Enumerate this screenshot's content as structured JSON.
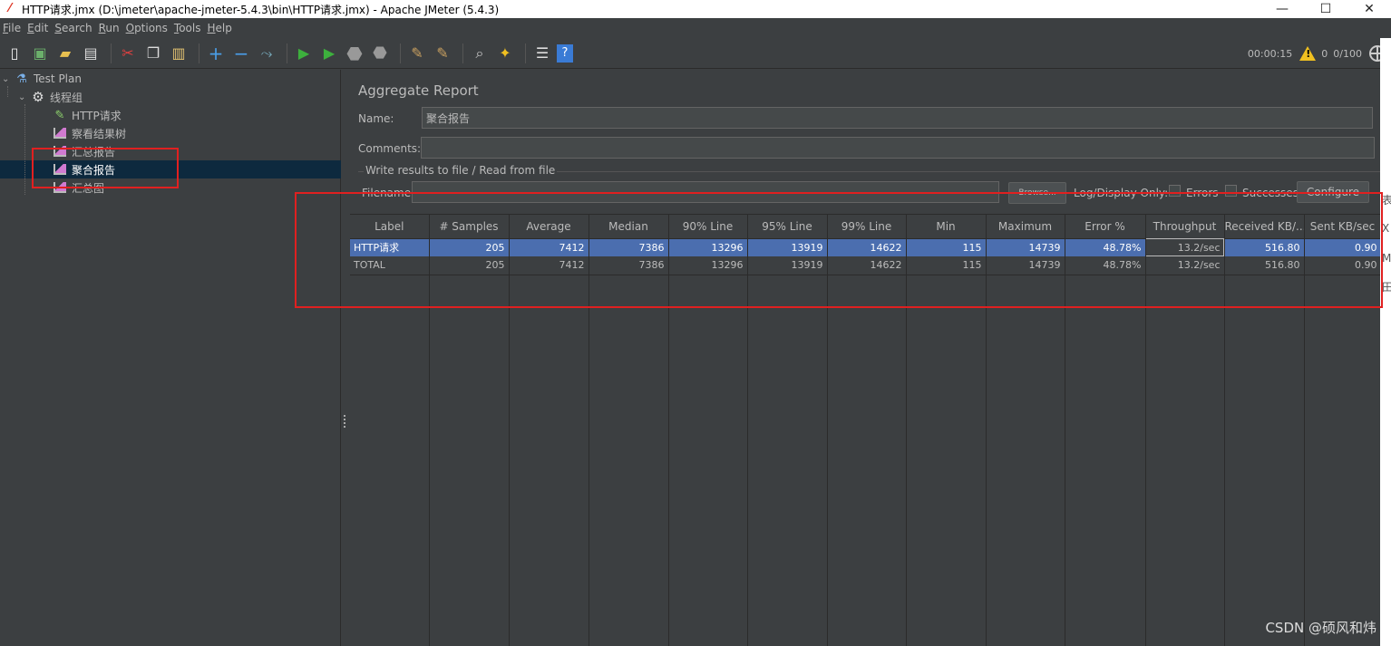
{
  "window": {
    "title": "HTTP请求.jmx (D:\\jmeter\\apache-jmeter-5.4.3\\bin\\HTTP请求.jmx) - Apache JMeter (5.4.3)",
    "controls": [
      "—",
      "☐",
      "✕"
    ]
  },
  "menu": [
    {
      "mnemonic": "F",
      "rest": "ile"
    },
    {
      "mnemonic": "E",
      "rest": "dit"
    },
    {
      "mnemonic": "S",
      "rest": "earch"
    },
    {
      "mnemonic": "R",
      "rest": "un"
    },
    {
      "mnemonic": "O",
      "rest": "ptions"
    },
    {
      "mnemonic": "T",
      "rest": "ools"
    },
    {
      "mnemonic": "H",
      "rest": "elp"
    }
  ],
  "toolbar": {
    "timer": "00:00:15",
    "warning_count": "0",
    "threads": "0/100",
    "icons": [
      "new-icon",
      "templates-icon",
      "open-icon",
      "save-icon",
      "cut-icon",
      "copy-icon",
      "paste-icon",
      "expand-icon",
      "collapse-icon",
      "toggle-icon",
      "start-icon",
      "start-no-pause-icon",
      "stop-icon",
      "shutdown-icon",
      "clear-icon",
      "clear-all-icon",
      "search-icon",
      "reset-search-icon",
      "function-helper-icon",
      "help-icon"
    ],
    "accent_start": "#3db03d",
    "accent_warning": "#f0c020"
  },
  "tree": {
    "test_plan": "Test Plan",
    "thread_group": "线程组",
    "http_request": "HTTP请求",
    "view_results_tree": "察看结果树",
    "summary_report": "汇总报告",
    "aggregate_report": "聚合报告",
    "graph": "汇总图"
  },
  "panel": {
    "title": "Aggregate Report",
    "name_label": "Name:",
    "name_value": "聚合报告",
    "comments_label": "Comments:",
    "comments_value": "",
    "file_group_title": "Write results to file / Read from file",
    "filename_label": "Filename",
    "filename_value": "",
    "browse_label": "Browse...",
    "log_display_label": "Log/Display Only:",
    "errors_label": "Errors",
    "successes_label": "Successes",
    "configure_label": "Configure"
  },
  "table": {
    "headers": [
      "Label",
      "# Samples",
      "Average",
      "Median",
      "90% Line",
      "95% Line",
      "99% Line",
      "Min",
      "Maximum",
      "Error %",
      "Throughput",
      "Received KB/...",
      "Sent KB/sec"
    ],
    "rows": [
      [
        "HTTP请求",
        "205",
        "7412",
        "7386",
        "13296",
        "13919",
        "14622",
        "115",
        "14739",
        "48.78%",
        "13.2/sec",
        "516.80",
        "0.90"
      ],
      [
        "TOTAL",
        "205",
        "7412",
        "7386",
        "13296",
        "13919",
        "14622",
        "115",
        "14739",
        "48.78%",
        "13.2/sec",
        "516.80",
        "0.90"
      ]
    ],
    "selection_color": "#4b6eaf"
  },
  "watermark": "CSDN @硕风和炜",
  "edge_chars": [
    "表",
    "X",
    "M",
    "田"
  ],
  "highlight_color": "#e02020"
}
